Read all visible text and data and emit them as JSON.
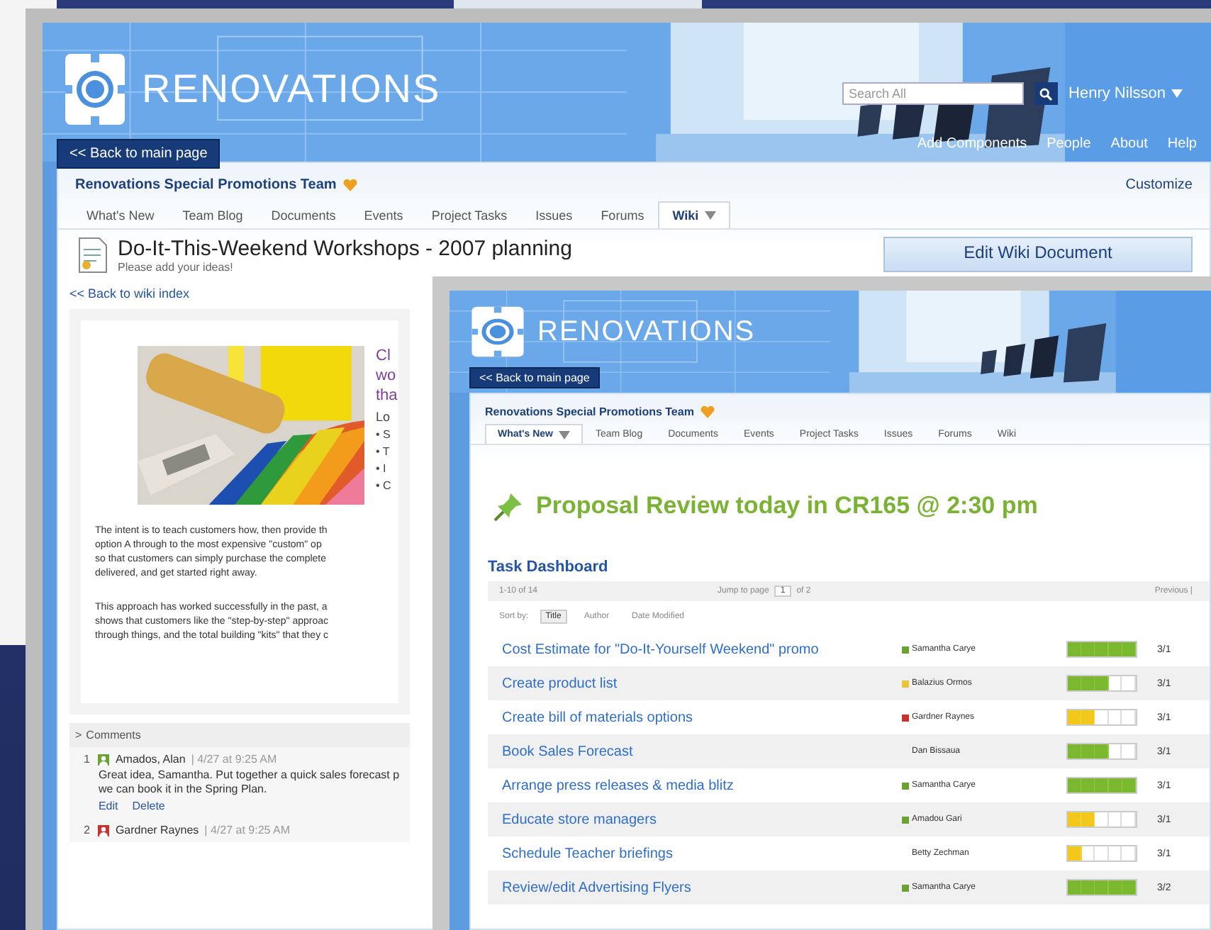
{
  "back_window": {
    "header": {
      "logo_text": "RENOVATIONS",
      "search": {
        "placeholder": "Search All"
      },
      "user": "Henry Nilsson",
      "back_button": "<< Back to main page",
      "links": [
        "Add Components",
        "People",
        "About",
        "Help"
      ]
    },
    "team": {
      "title": "Renovations Special Promotions Team",
      "customize": "Customize"
    },
    "tabs": [
      {
        "label": "What's New",
        "selected": false
      },
      {
        "label": "Team Blog",
        "selected": false
      },
      {
        "label": "Documents",
        "selected": false
      },
      {
        "label": "Events",
        "selected": false
      },
      {
        "label": "Project Tasks",
        "selected": false
      },
      {
        "label": "Issues",
        "selected": false
      },
      {
        "label": "Forums",
        "selected": false
      },
      {
        "label": "Wiki",
        "selected": true
      }
    ],
    "page": {
      "title": "Do-It-This-Weekend Workshops - 2007 planning",
      "subtitle": "Please add your ideas!",
      "edit_button": "Edit Wiki Document",
      "back_link": "<< Back to wiki index"
    },
    "article": {
      "heading": "Cl\nwo\ntha",
      "list_title": "Lo",
      "bullets": [
        "• S",
        "• T",
        "• I",
        "• C"
      ],
      "paragraphs": [
        "The intent is to teach customers how, then provide th\noption A through to the most expensive \"custom\" op\nso that customers can simply purchase the complete\ndelivered, and get started right away.",
        "This approach has worked successfully in the past, a\nshows that customers like the \"step-by-step\" approac\nthrough things, and the total building \"kits\" that they c"
      ]
    },
    "comments": {
      "toggle": ">",
      "title": "Comments",
      "items": [
        {
          "number": "1",
          "author": "Amados, Alan",
          "color": "#6aa334",
          "time": "| 4/27 at 9:25 AM",
          "text": "Great idea, Samantha. Put together a quick sales forecast p\nwe can book it in the Spring Plan.",
          "actions": [
            "Edit",
            "Delete"
          ]
        },
        {
          "number": "2",
          "author": "Gardner Raynes",
          "color": "#c8322f",
          "time": "| 4/27 at 9:25 AM"
        }
      ]
    }
  },
  "front_window": {
    "header": {
      "logo_text": "RENOVATIONS",
      "back_button": "<< Back to main page"
    },
    "team": {
      "title": "Renovations Special Promotions Team"
    },
    "tabs": [
      {
        "label": "What's New",
        "selected": true
      },
      {
        "label": "Team Blog",
        "selected": false
      },
      {
        "label": "Documents",
        "selected": false
      },
      {
        "label": "Events",
        "selected": false
      },
      {
        "label": "Project Tasks",
        "selected": false
      },
      {
        "label": "Issues",
        "selected": false
      },
      {
        "label": "Forums",
        "selected": false
      },
      {
        "label": "Wiki",
        "selected": false
      }
    ],
    "announcement": "Proposal Review today in CR165 @ 2:30 pm",
    "dashboard": {
      "title": "Task Dashboard",
      "count": "1-10 of 14",
      "jump_label": "Jump to page",
      "page": "1",
      "of_pages": "of 2",
      "previous": "Previous |",
      "sort_label": "Sort by:",
      "sort_options": [
        {
          "label": "Title",
          "selected": true
        },
        {
          "label": "Author",
          "selected": false
        },
        {
          "label": "Date Modified",
          "selected": false
        }
      ],
      "rows": [
        {
          "title": "Cost Estimate for \"Do-It-Yourself Weekend\" promo",
          "author": "Samantha Carye",
          "color": "#6aa334",
          "level": 1,
          "date": "3/1"
        },
        {
          "title": "Create product list",
          "author": "Balazius Ormos",
          "color": "#e8c53a",
          "level": 0.6,
          "date": "3/1"
        },
        {
          "title": "Create bill of materials options",
          "author": "Gardner Raynes",
          "color": "#c8322f",
          "level": 0.4,
          "date": "3/1"
        },
        {
          "title": "Book Sales Forecast",
          "author": "Dan Bissaua",
          "level": 0.6,
          "date": "3/1"
        },
        {
          "title": "Arrange press releases & media blitz",
          "author": "Samantha Carye",
          "color": "#6aa334",
          "level": 1,
          "date": "3/1"
        },
        {
          "title": "Educate store managers",
          "author": "Amadou Gari",
          "color": "#6aa334",
          "level": 0.4,
          "date": "3/1"
        },
        {
          "title": "Schedule Teacher briefings",
          "author": "Betty Zechman",
          "level": 0.2,
          "date": "3/1"
        },
        {
          "title": "Review/edit Advertising Flyers",
          "author": "Samantha Carye",
          "color": "#6aa334",
          "level": 1,
          "date": "3/2"
        }
      ]
    }
  }
}
